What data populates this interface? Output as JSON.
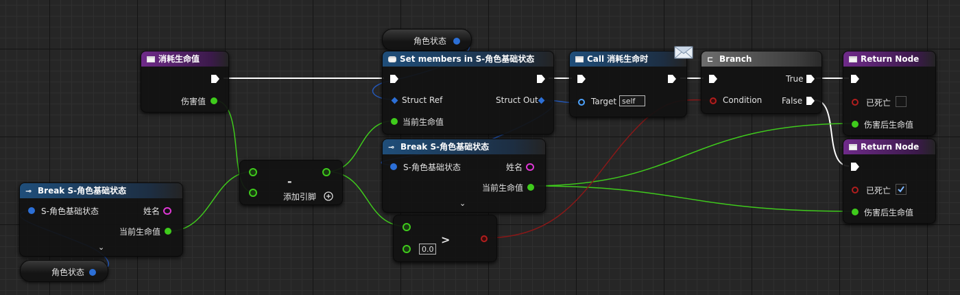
{
  "nodes": {
    "consume_hp_entry": {
      "title": "消耗生命值",
      "pin_damage": "伤害值"
    },
    "set_members": {
      "title": "Set members in S-角色基础状态",
      "struct_ref": "Struct Ref",
      "struct_out": "Struct Out",
      "current_hp": "当前生命值"
    },
    "call_consume": {
      "title": "Call 消耗生命时",
      "target": "Target",
      "target_value": "self"
    },
    "branch": {
      "title": "Branch",
      "condition": "Condition",
      "true_label": "True",
      "false_label": "False"
    },
    "return_true": {
      "title": "Return Node",
      "dead": "已死亡",
      "dead_checked": false,
      "hp_after": "伤害后生命值"
    },
    "return_false": {
      "title": "Return Node",
      "dead": "已死亡",
      "dead_checked": true,
      "hp_after": "伤害后生命值"
    },
    "break_mid": {
      "title": "Break S-角色基础状态",
      "in_struct": "S-角色基础状态",
      "name": "姓名",
      "current_hp": "当前生命值"
    },
    "break_left": {
      "title": "Break S-角色基础状态",
      "in_struct": "S-角色基础状态",
      "name": "姓名",
      "current_hp": "当前生命值"
    },
    "subtract": {
      "symbol": "-",
      "add_pin": "添加引脚"
    },
    "greater": {
      "symbol": ">",
      "value": "0.0"
    },
    "var_top": {
      "label": "角色状态"
    },
    "var_bottom": {
      "label": "角色状态"
    }
  },
  "colors": {
    "exec_wire": "#ffffff",
    "float_wire": "#3fcb1c",
    "struct_wire": "#2458b8",
    "bool_wire": "#8a1818",
    "function_header": "#6f2b8a",
    "struct_header": "#1f4e7a",
    "branch_header": "#6d6d6d"
  }
}
